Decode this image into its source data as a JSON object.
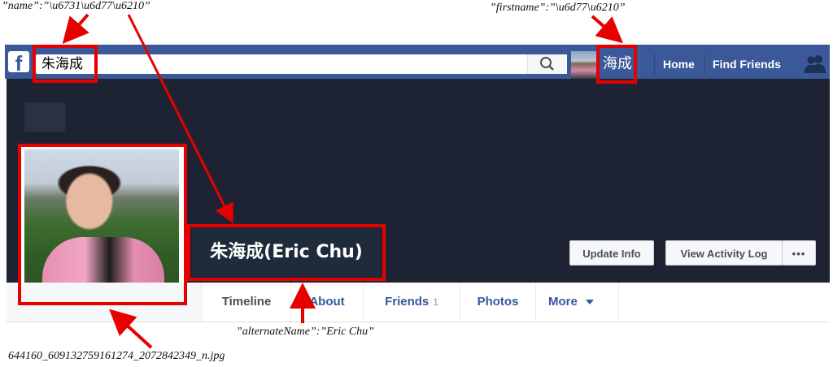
{
  "annotations": {
    "name_json": "”name”:”\\u6731\\u6d77\\u6210”",
    "firstname_json": "”firstname”:”\\u6d77\\u6210”",
    "alternate_name_json": "”alternateName”:”Eric Chu”",
    "photo_filename": "644160_609132759161274_2072842349_n.jpg",
    "highlight_color": "#e60000"
  },
  "topbar": {
    "logo_letter": "f",
    "search_value": "朱海成",
    "search_icon": "search-icon",
    "first_name": "海成",
    "links": [
      "Home",
      "Find Friends"
    ],
    "friends_icon": "friends-icon",
    "bg_color": "#3b5998"
  },
  "profile": {
    "display_name": "朱海成(Eric Chu)",
    "update_info_label": "Update Info",
    "view_activity_log_label": "View Activity Log",
    "more_actions_label": "•••"
  },
  "tabs": [
    {
      "label": "Timeline"
    },
    {
      "label": "About"
    },
    {
      "label": "Friends",
      "count": "1"
    },
    {
      "label": "Photos"
    },
    {
      "label": "More"
    }
  ]
}
